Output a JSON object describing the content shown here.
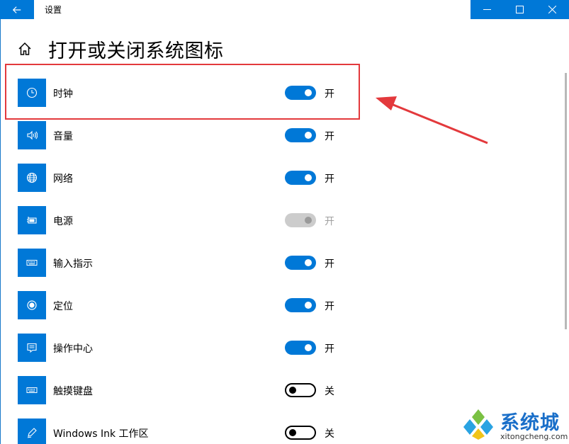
{
  "window": {
    "title": "设置",
    "back_icon": "back-arrow-icon",
    "controls": [
      "minimize-icon",
      "maximize-icon",
      "close-icon"
    ]
  },
  "page": {
    "home_icon": "home-icon",
    "title": "打开或关闭系统图标"
  },
  "rows": [
    {
      "icon": "clock-icon",
      "label": "时钟",
      "state": "on",
      "state_label": "开"
    },
    {
      "icon": "volume-icon",
      "label": "音量",
      "state": "on",
      "state_label": "开"
    },
    {
      "icon": "globe-icon",
      "label": "网络",
      "state": "on",
      "state_label": "开"
    },
    {
      "icon": "battery-icon",
      "label": "电源",
      "state": "disabled",
      "state_label": "开"
    },
    {
      "icon": "keyboard-icon",
      "label": "输入指示",
      "state": "on",
      "state_label": "开"
    },
    {
      "icon": "location-icon",
      "label": "定位",
      "state": "on",
      "state_label": "开"
    },
    {
      "icon": "action-center-icon",
      "label": "操作中心",
      "state": "on",
      "state_label": "开"
    },
    {
      "icon": "keyboard-icon",
      "label": "触摸键盘",
      "state": "off",
      "state_label": "关"
    },
    {
      "icon": "pen-icon",
      "label": "Windows Ink 工作区",
      "state": "off",
      "state_label": "关"
    }
  ],
  "annotation": {
    "highlight_color": "#e3393c"
  },
  "watermark": {
    "brand": "系统城",
    "url": "xitongcheng.com"
  },
  "colors": {
    "accent": "#0078d7",
    "disabled": "#cccccc"
  }
}
